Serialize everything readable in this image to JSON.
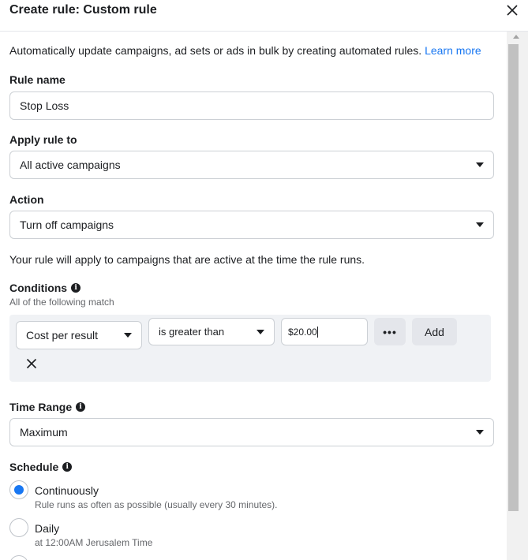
{
  "header": {
    "title": "Create rule: Custom rule"
  },
  "intro": {
    "text": "Automatically update campaigns, ad sets or ads in bulk by creating automated rules. ",
    "link": "Learn more"
  },
  "rule_name": {
    "label": "Rule name",
    "value": "Stop Loss"
  },
  "apply_rule": {
    "label": "Apply rule to",
    "value": "All active campaigns"
  },
  "action": {
    "label": "Action",
    "value": "Turn off campaigns"
  },
  "apply_note": "Your rule will apply to campaigns that are active at the time the rule runs.",
  "conditions": {
    "label": "Conditions",
    "sublabel": "All of the following match",
    "metric": "Cost per result",
    "operator": "is greater than",
    "value": "$20.00",
    "more": "•••",
    "add": "Add"
  },
  "time_range": {
    "label": "Time Range",
    "value": "Maximum"
  },
  "schedule": {
    "label": "Schedule",
    "options": [
      {
        "label": "Continuously",
        "sub": "Rule runs as often as possible (usually every 30 minutes).",
        "checked": true
      },
      {
        "label": "Daily",
        "sub": "at 12:00AM Jerusalem Time",
        "checked": false
      }
    ]
  },
  "colors": {
    "accent": "#1877f2",
    "border": "#ccd0d5",
    "muted": "#65676b"
  }
}
